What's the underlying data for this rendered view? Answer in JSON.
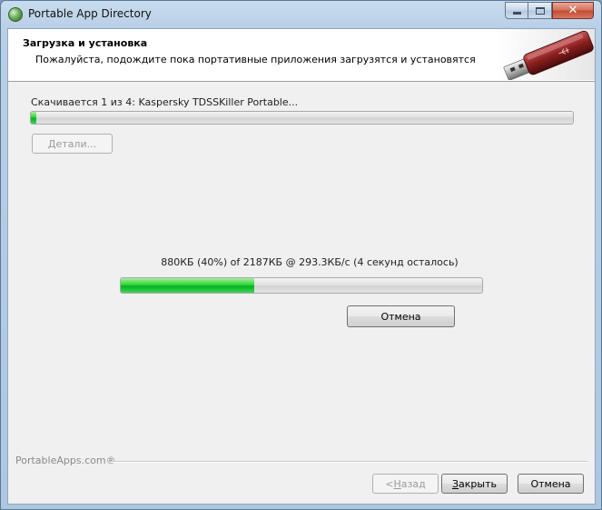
{
  "window": {
    "title": "Portable App Directory",
    "icon": "portableapps-icon",
    "controls": {
      "minimize": "minimize-icon",
      "maximize": "maximize-icon",
      "close": "close-icon"
    }
  },
  "header": {
    "title": "Загрузка и установка",
    "subtitle": "Пожалуйста, подождите пока портативные приложения загрузятся и установятся",
    "image": "usb-drive-icon"
  },
  "download": {
    "status": "Скачивается 1 из 4: Kaspersky TDSSKiller Portable...",
    "overall_progress": 0.01,
    "details_label": "Детали...",
    "details_enabled": false
  },
  "transfer": {
    "text": "880КБ (40%) of 2187КБ @ 293.3КБ/с (4 секунд осталось)",
    "progress": 0.37,
    "cancel_label": "Отмена"
  },
  "footer": {
    "brand": "PortableApps.com®",
    "back_label_prefix": "< ",
    "back_label_accel": "Н",
    "back_label_rest": "азад",
    "close_label_accel": "З",
    "close_label_rest": "акрыть",
    "cancel_label": "Отмена",
    "back_enabled": false
  },
  "colors": {
    "progress_green": "#06b025",
    "header_bg": "#ffffff",
    "client_bg": "#f0f0f0",
    "usb_red": "#8b1f1f"
  }
}
